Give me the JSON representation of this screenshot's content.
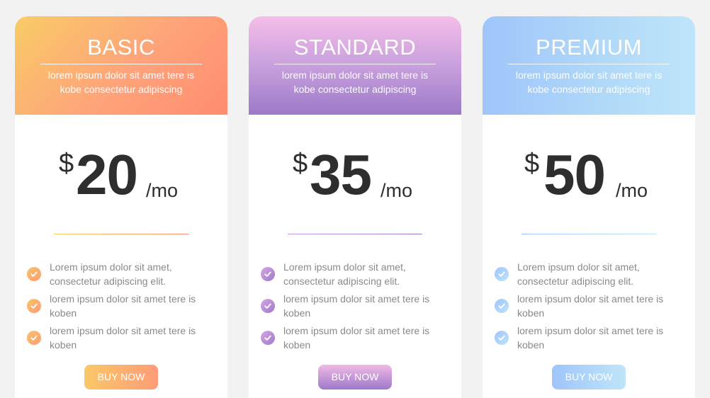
{
  "plans": [
    {
      "name": "BASIC",
      "description": "lorem ipsum dolor sit amet tere is kobe consectetur adipiscing",
      "currency": "$",
      "price": "20",
      "period": "/mo",
      "features": [
        "Lorem ipsum dolor sit amet, consectetur adipiscing elit.",
        "lorem ipsum dolor sit amet tere is koben",
        "lorem ipsum dolor sit amet tere is koben"
      ],
      "button_label": "BUY NOW",
      "accent_colors": [
        "#f9cc67",
        "#fe8c6f"
      ]
    },
    {
      "name": "STANDARD",
      "description": "lorem ipsum dolor sit amet tere is kobe consectetur adipiscing",
      "currency": "$",
      "price": "35",
      "period": "/mo",
      "features": [
        "Lorem ipsum dolor sit amet, consectetur adipiscing elit.",
        "lorem ipsum dolor sit amet tere is koben",
        "lorem ipsum dolor sit amet tere is koben"
      ],
      "button_label": "BUY NOW",
      "accent_colors": [
        "#f6bde8",
        "#9d7ac9"
      ]
    },
    {
      "name": "PREMIUM",
      "description": "lorem ipsum dolor sit amet tere is kobe consectetur adipiscing",
      "currency": "$",
      "price": "50",
      "period": "/mo",
      "features": [
        "Lorem ipsum dolor sit amet, consectetur adipiscing elit.",
        "lorem ipsum dolor sit amet tere is koben",
        "lorem ipsum dolor sit amet tere is koben"
      ],
      "button_label": "BUY NOW",
      "accent_colors": [
        "#9fc5fb",
        "#bfe5fa"
      ]
    }
  ],
  "icons": {
    "feature_bullet": "check-icon"
  },
  "background_color": "#f2f2f2"
}
